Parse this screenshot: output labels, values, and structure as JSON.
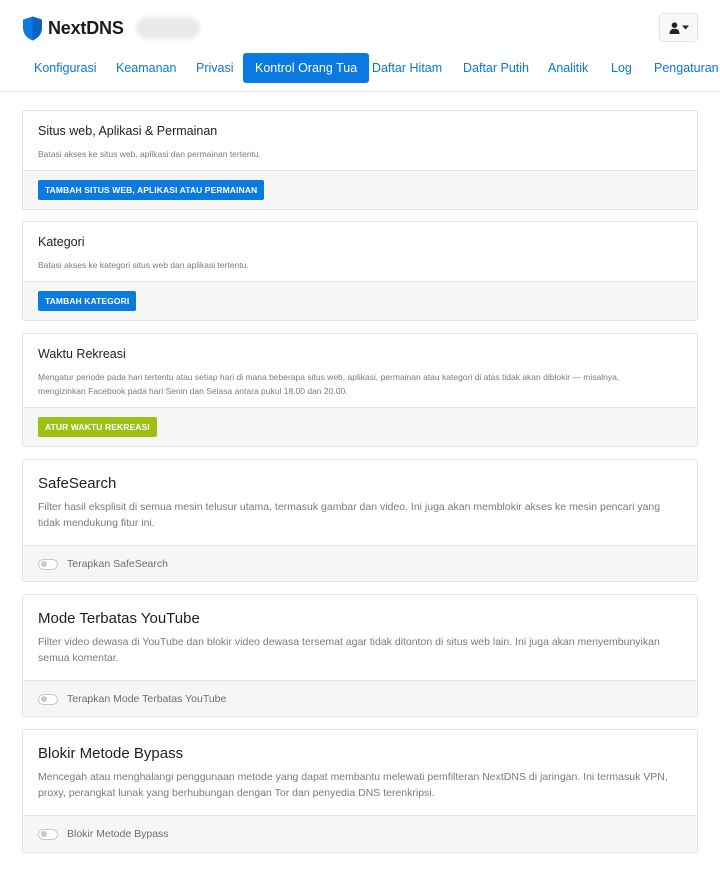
{
  "header": {
    "brand_name": "NextDNS",
    "profile_name": "",
    "user_menu_icon": "user-icon",
    "caret_icon": "caret-down-icon"
  },
  "colors": {
    "accent": "#0b7ae0",
    "green": "#9ec014",
    "footer_bg": "#f6f6f6"
  },
  "nav": {
    "tabs": [
      {
        "label": "Konfigurasi",
        "active": false
      },
      {
        "label": "Keamanan",
        "active": false
      },
      {
        "label": "Privasi",
        "active": false
      },
      {
        "label": "Kontrol Orang Tua",
        "active": true
      },
      {
        "label": "Daftar Hitam",
        "active": false
      },
      {
        "label": "Daftar Putih",
        "active": false
      },
      {
        "label": "Analitik",
        "active": false
      },
      {
        "label": "Log",
        "active": false
      },
      {
        "label": "Pengaturan",
        "active": false
      }
    ]
  },
  "sections": {
    "websites": {
      "title": "Situs web, Aplikasi & Permainan",
      "description": "Batasi akses ke situs web, aplikasi dan permainan tertentu.",
      "button": "TAMBAH SITUS WEB, APLIKASI ATAU PERMAINAN"
    },
    "categories": {
      "title": "Kategori",
      "description": "Batasi akses ke kategori situs web dan aplikasi tertentu.",
      "button": "TAMBAH KATEGORI"
    },
    "recreation": {
      "title": "Waktu Rekreasi",
      "description": "Mengatur periode pada hari tertentu atau setiap hari di mana beberapa situs web, aplikasi, permainan atau kategori di atas tidak akan diblokir — misalnya, mengizinkan Facebook pada hari Senin dan Selasa antara pukul 18.00 dan 20.00.",
      "button": "ATUR WAKTU REKREASI"
    },
    "safesearch": {
      "title": "SafeSearch",
      "description": "Filter hasil eksplisit di semua mesin telusur utama, termasuk gambar dan video. Ini juga akan memblokir akses ke mesin pencari yang tidak mendukung fitur ini.",
      "toggle_label": "Terapkan SafeSearch",
      "enabled": false
    },
    "youtube": {
      "title": "Mode Terbatas YouTube",
      "description": "Filter video dewasa di YouTube dan blokir video dewasa tersemat agar tidak ditonton di situs web lain. Ini juga akan menyembunyikan semua komentar.",
      "toggle_label": "Terapkan Mode Terbatas YouTube",
      "enabled": false
    },
    "bypass": {
      "title": "Blokir Metode Bypass",
      "description": "Mencegah atau menghalangi penggunaan metode yang dapat membantu melewati pemfilteran NextDNS di jaringan. Ini termasuk VPN, proxy, perangkat lunak yang berhubungan dengan Tor dan penyedia DNS terenkripsi.",
      "toggle_label": "Blokir Metode Bypass",
      "enabled": false
    }
  }
}
